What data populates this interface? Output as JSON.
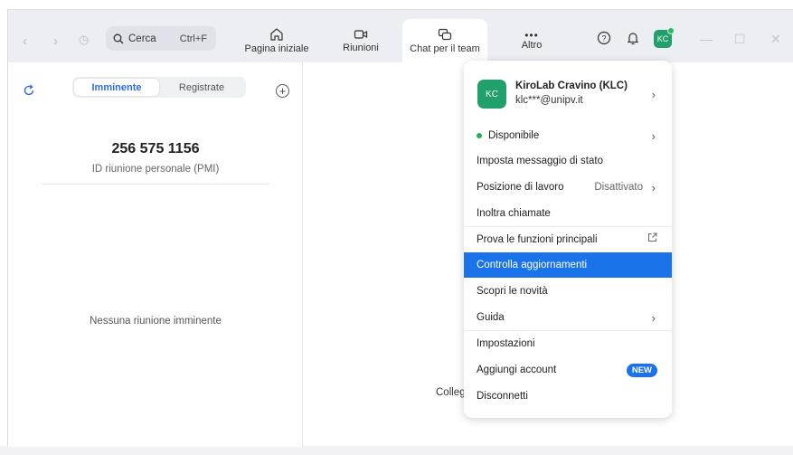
{
  "topbar": {
    "search_label": "Cerca",
    "search_shortcut": "Ctrl+F",
    "tabs": [
      {
        "label": "Pagina iniziale"
      },
      {
        "label": "Riunioni"
      },
      {
        "label": "Chat per il team"
      },
      {
        "label": "Altro"
      }
    ],
    "avatar_initials": "KC"
  },
  "left_panel": {
    "segments": {
      "active": "Imminente",
      "inactive": "Registrate"
    },
    "pmi_number": "256 575 1156",
    "pmi_label": "ID riunione personale (PMI)",
    "empty_text": "Nessuna riunione imminente"
  },
  "behind_text": "Colleg",
  "menu": {
    "avatar_initials": "KC",
    "name": "KiroLab Cravino (KLC)",
    "email": "klc***@unipv.it",
    "items": [
      {
        "label": "Disponibile"
      },
      {
        "label": "Imposta messaggio di stato"
      },
      {
        "label": "Posizione di lavoro",
        "extra": "Disattivato"
      },
      {
        "label": "Inoltra chiamate"
      },
      {
        "label": "Prova le funzioni principali"
      },
      {
        "label": "Controlla aggiornamenti"
      },
      {
        "label": "Scopri le novità"
      },
      {
        "label": "Guida"
      },
      {
        "label": "Impostazioni"
      },
      {
        "label": "Aggiungi account",
        "badge": "NEW"
      },
      {
        "label": "Disconnetti"
      }
    ]
  },
  "colors": {
    "accent": "#1a73e8",
    "avatar": "#22a06b",
    "status": "#20b25b"
  }
}
